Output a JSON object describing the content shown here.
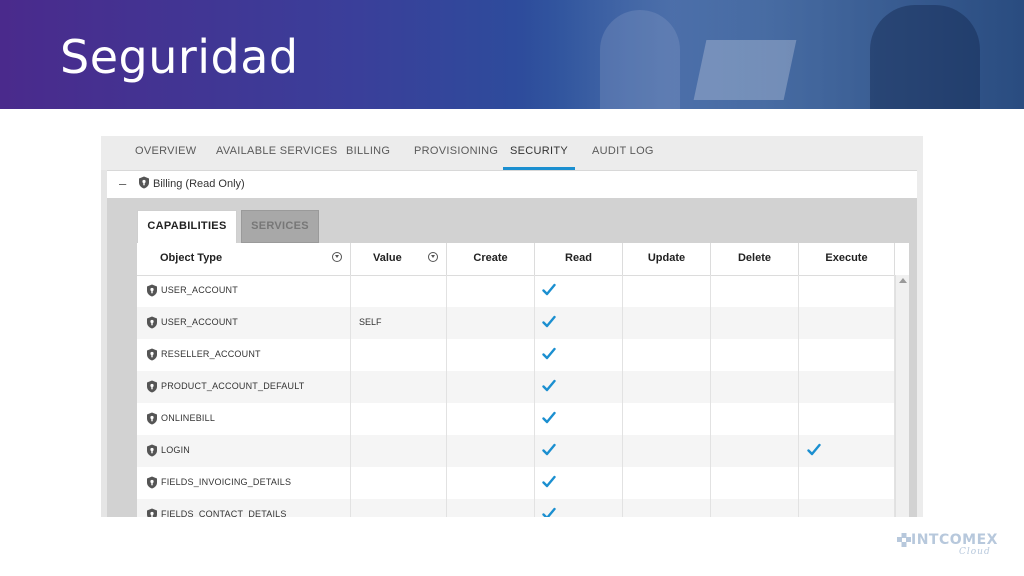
{
  "slide": {
    "title": "Seguridad"
  },
  "nav": {
    "tabs": [
      {
        "label": "OVERVIEW"
      },
      {
        "label": "AVAILABLE SERVICES"
      },
      {
        "label": "BILLING"
      },
      {
        "label": "PROVISIONING"
      },
      {
        "label": "SECURITY",
        "active": true
      },
      {
        "label": "AUDIT LOG"
      }
    ]
  },
  "group": {
    "collapse_symbol": "–",
    "label": "Billing (Read Only)",
    "icon": "shield-icon"
  },
  "subtabs": {
    "capabilities": "CAPABILITIES",
    "services": "SERVICES"
  },
  "grid": {
    "columns": [
      "Object Type",
      "Value",
      "Create",
      "Read",
      "Update",
      "Delete",
      "Execute"
    ],
    "rows": [
      {
        "object_type": "USER_ACCOUNT",
        "value": "",
        "create": false,
        "read": true,
        "update": false,
        "delete": false,
        "execute": false
      },
      {
        "object_type": "USER_ACCOUNT",
        "value": "SELF",
        "create": false,
        "read": true,
        "update": false,
        "delete": false,
        "execute": false
      },
      {
        "object_type": "RESELLER_ACCOUNT",
        "value": "",
        "create": false,
        "read": true,
        "update": false,
        "delete": false,
        "execute": false
      },
      {
        "object_type": "PRODUCT_ACCOUNT_DEFAULT",
        "value": "",
        "create": false,
        "read": true,
        "update": false,
        "delete": false,
        "execute": false
      },
      {
        "object_type": "ONLINEBILL",
        "value": "",
        "create": false,
        "read": true,
        "update": false,
        "delete": false,
        "execute": false
      },
      {
        "object_type": "LOGIN",
        "value": "",
        "create": false,
        "read": true,
        "update": false,
        "delete": false,
        "execute": true
      },
      {
        "object_type": "FIELDS_INVOICING_DETAILS",
        "value": "",
        "create": false,
        "read": true,
        "update": false,
        "delete": false,
        "execute": false
      },
      {
        "object_type": "FIELDS_CONTACT_DETAILS",
        "value": "",
        "create": false,
        "read": true,
        "update": false,
        "delete": false,
        "execute": false
      }
    ]
  },
  "logo": {
    "text": "INTCOMEX",
    "sub": "Cloud"
  },
  "colors": {
    "accent": "#1b8fd0",
    "check": "#1b8fd0",
    "banner_start": "#4a2a8c",
    "banner_end": "#2d5a92"
  }
}
